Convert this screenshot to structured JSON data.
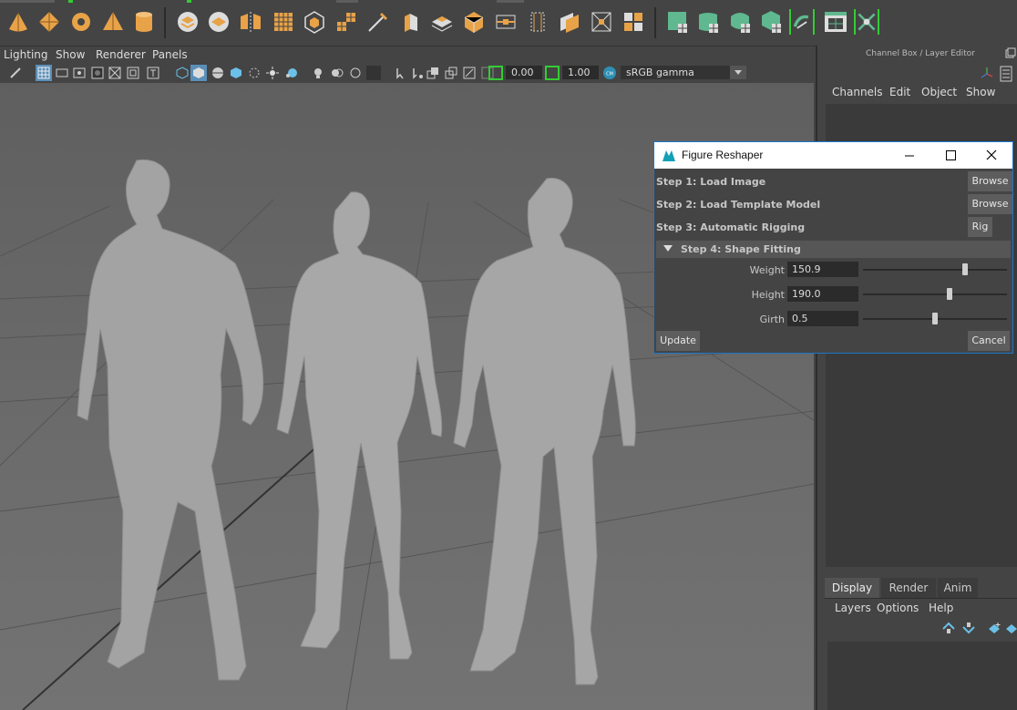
{
  "viewport_menu": [
    "Lighting",
    "Show",
    "Renderer",
    "Panels"
  ],
  "viewport_toolbar": {
    "exposure": "0.00",
    "gamma": "1.00",
    "color_space": "sRGB gamma"
  },
  "channel_box": {
    "title": "Channel Box / Layer Editor",
    "menu": [
      "Channels",
      "Edit",
      "Object",
      "Show"
    ]
  },
  "layer_editor": {
    "tabs": [
      "Display",
      "Render",
      "Anim"
    ],
    "active_tab": "Display",
    "menu": [
      "Layers",
      "Options",
      "Help"
    ]
  },
  "figure_reshaper": {
    "title": "Figure Reshaper",
    "steps": [
      {
        "label": "Step 1: Load Image",
        "button": "Browse"
      },
      {
        "label": "Step 2: Load Template Model",
        "button": "Browse"
      },
      {
        "label": "Step 3: Automatic Rigging",
        "button": "Rig"
      }
    ],
    "section": "Step 4: Shape Fitting",
    "params": [
      {
        "label": "Weight",
        "value": "150.9",
        "slider": 0.71
      },
      {
        "label": "Height",
        "value": "190.0",
        "slider": 0.6
      },
      {
        "label": "Girth",
        "value": "0.5",
        "slider": 0.5
      }
    ],
    "update_button": "Update",
    "cancel_button": "Cancel"
  },
  "colors": {
    "accent_orange": "#e8a248",
    "accent_green": "#5fb88f",
    "window_border": "#1b76c9"
  }
}
